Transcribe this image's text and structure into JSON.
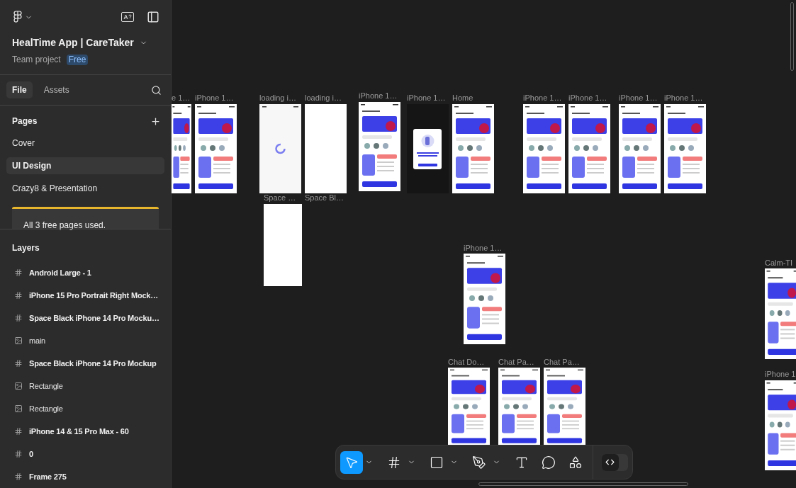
{
  "project": {
    "title": "HealTime App | CareTaker",
    "subtitle": "Team project",
    "plan": "Free"
  },
  "tabs": [
    {
      "label": "File",
      "selected": true
    },
    {
      "label": "Assets",
      "selected": false
    }
  ],
  "pages": {
    "heading": "Pages",
    "items": [
      {
        "label": "Cover",
        "selected": false
      },
      {
        "label": "UI Design",
        "selected": true
      },
      {
        "label": "Crazy8 & Presentation",
        "selected": false
      }
    ],
    "notice": "All 3 free pages used."
  },
  "layers": {
    "heading": "Layers",
    "items": [
      {
        "kind": "frame",
        "label": "Android Large - 1"
      },
      {
        "kind": "frame",
        "label": "iPhone 15 Pro Portrait Right Mock…"
      },
      {
        "kind": "frame",
        "label": "Space Black iPhone 14 Pro Mocku…"
      },
      {
        "kind": "image",
        "label": "main"
      },
      {
        "kind": "frame",
        "label": "Space Black iPhone 14 Pro Mockup"
      },
      {
        "kind": "image",
        "label": "Rectangle"
      },
      {
        "kind": "image",
        "label": "Rectangle"
      },
      {
        "kind": "frame",
        "label": "iPhone 14 & 15 Pro Max - 60"
      },
      {
        "kind": "frame",
        "label": "0"
      },
      {
        "kind": "frame",
        "label": "Frame 275"
      }
    ]
  },
  "canvas": {
    "frames": [
      {
        "label": "e 1…",
        "kind": "screen"
      },
      {
        "label": "iPhone 1…",
        "kind": "screen"
      },
      {
        "label": "loading i…",
        "kind": "spinner"
      },
      {
        "label": "loading i…",
        "kind": "blank"
      },
      {
        "label": "Space …",
        "kind": "blank"
      },
      {
        "label": "Space Bl…",
        "kind": "none"
      },
      {
        "label": "iPhone 1…",
        "kind": "screen"
      },
      {
        "label": "iPhone 1…",
        "kind": "dark"
      },
      {
        "label": "Home",
        "kind": "screen"
      },
      {
        "label": "iPhone 1…",
        "kind": "screen"
      },
      {
        "label": "iPhone 1…",
        "kind": "screen"
      },
      {
        "label": "iPhone 1…",
        "kind": "screen"
      },
      {
        "label": "iPhone 1…",
        "kind": "screen"
      },
      {
        "label": "iPhone 1…",
        "kind": "screen"
      },
      {
        "label": "Chat Do…",
        "kind": "screen"
      },
      {
        "label": "Chat Pa…",
        "kind": "screen"
      },
      {
        "label": "Chat Pa…",
        "kind": "screen"
      },
      {
        "label": "Calm-TI",
        "kind": "screen"
      },
      {
        "label": "iPhone 1",
        "kind": "screen"
      }
    ]
  },
  "toolbar": {
    "tools": [
      {
        "kind": "move",
        "selected": true
      },
      {
        "kind": "frame",
        "selected": false
      },
      {
        "kind": "rectangle",
        "selected": false
      },
      {
        "kind": "pen",
        "selected": false
      },
      {
        "kind": "text",
        "selected": false
      },
      {
        "kind": "comment",
        "selected": false
      },
      {
        "kind": "actions",
        "selected": false
      }
    ],
    "dev_mode": {
      "on": false
    }
  }
}
